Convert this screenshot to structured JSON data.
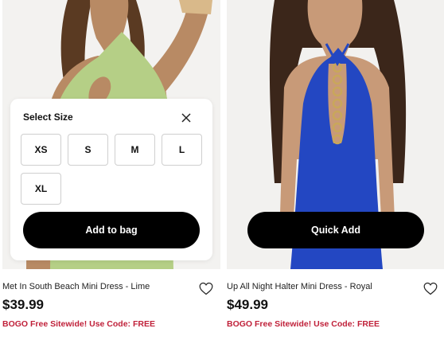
{
  "size_selector": {
    "title": "Select Size",
    "sizes": [
      "XS",
      "S",
      "M",
      "L",
      "XL"
    ],
    "add_label": "Add to bag",
    "close_icon": "close-icon"
  },
  "products": [
    {
      "name": "Met In South Beach Mini Dress - Lime",
      "price": "$39.99",
      "promo": "BOGO Free Sitewide! Use Code: FREE",
      "dress_color": "#b5cf86",
      "wishlist_icon": "heart-icon"
    },
    {
      "name": "Up All Night Halter Mini Dress - Royal",
      "price": "$49.99",
      "promo": "BOGO Free Sitewide! Use Code: FREE",
      "quick_add_label": "Quick Add",
      "dress_color": "#2347c2",
      "wishlist_icon": "heart-icon"
    }
  ],
  "colors": {
    "promo": "#c0213a",
    "button": "#000000",
    "background": "#f2f1ef"
  }
}
